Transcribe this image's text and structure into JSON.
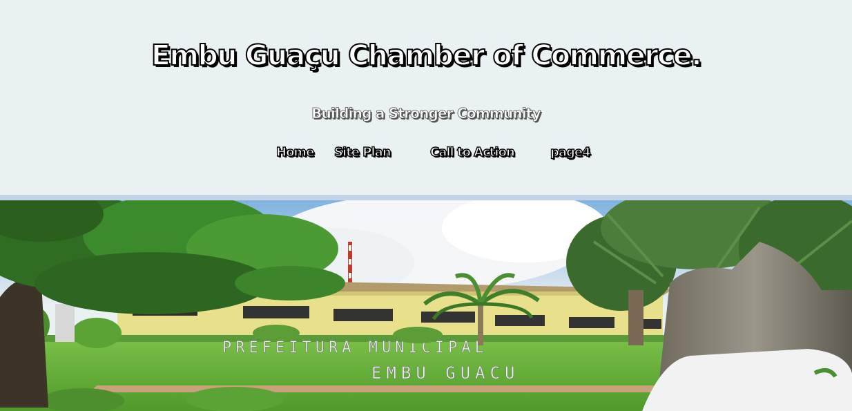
{
  "header": {
    "title": "Embu Guaçu Chamber of Commerce.",
    "tagline": "Building a Stronger Community"
  },
  "nav": {
    "items": [
      {
        "label": "Home"
      },
      {
        "label": "Site Plan"
      },
      {
        "label": "Call to Action"
      },
      {
        "label": "page4"
      }
    ]
  },
  "hero": {
    "sign_line1": "PREFEITURA MUNICIPAL",
    "sign_line2": "EMBU GUACU"
  },
  "colors": {
    "header_bg": "#e9f1f3",
    "divider": "#c3d3e8",
    "building_wall": "#e8e08a",
    "grass": "#6eb83c"
  }
}
